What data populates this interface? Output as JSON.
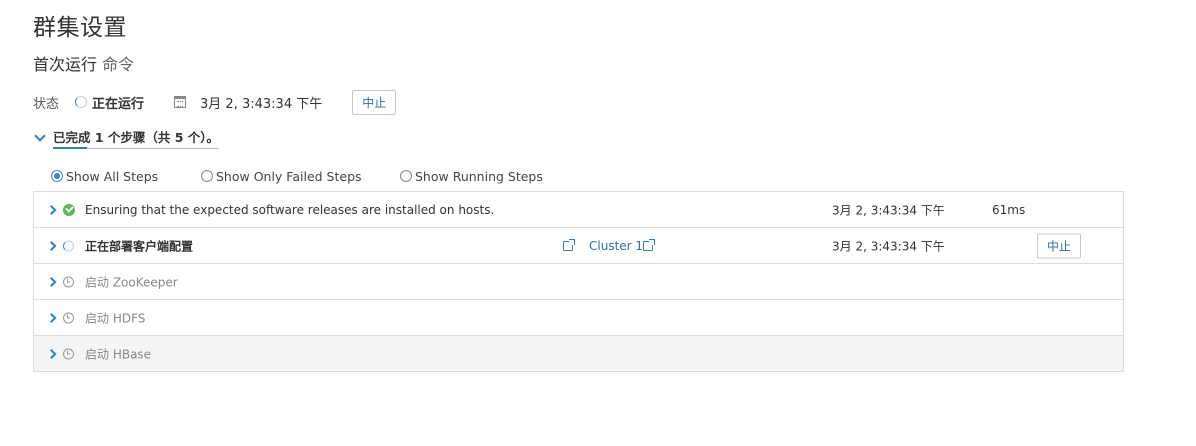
{
  "page": {
    "title": "群集设置",
    "subtitle_main": "首次运行",
    "subtitle_muted": "命令"
  },
  "status": {
    "label": "状态",
    "value": "正在运行",
    "time": "3月 2, 3:43:34 下午",
    "abort_label": "中止"
  },
  "summary": {
    "text": "已完成 1 个步骤（共 5 个）。"
  },
  "filters": [
    {
      "label": "Show All Steps",
      "checked": true
    },
    {
      "label": "Show Only Failed Steps",
      "checked": false
    },
    {
      "label": "Show Running Steps",
      "checked": false
    }
  ],
  "steps": [
    {
      "name": "Ensuring that the expected software releases are installed on hosts.",
      "status": "completed",
      "time": "3月 2, 3:43:34 下午",
      "duration": "61ms"
    },
    {
      "name": "正在部署客户端配置",
      "status": "running",
      "link_label": "Cluster 1",
      "time": "3月 2, 3:43:34 下午",
      "abort_label": "中止"
    },
    {
      "name": "启动 ZooKeeper",
      "status": "pending"
    },
    {
      "name": "启动 HDFS",
      "status": "pending"
    },
    {
      "name": "启动 HBase",
      "status": "pending"
    }
  ],
  "colors": {
    "accent": "#2a7fc0",
    "success": "#5cb85c",
    "border": "#dcdcdc"
  }
}
